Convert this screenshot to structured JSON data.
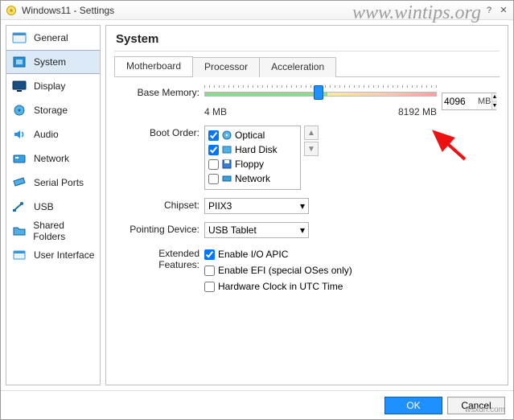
{
  "window": {
    "title": "Windows11 - Settings"
  },
  "watermark": "www.wintips.org",
  "watermark2": "wsxdn.com",
  "sidebar": {
    "items": [
      {
        "label": "General"
      },
      {
        "label": "System"
      },
      {
        "label": "Display"
      },
      {
        "label": "Storage"
      },
      {
        "label": "Audio"
      },
      {
        "label": "Network"
      },
      {
        "label": "Serial Ports"
      },
      {
        "label": "USB"
      },
      {
        "label": "Shared Folders"
      },
      {
        "label": "User Interface"
      }
    ],
    "selected": 1
  },
  "page": {
    "title": "System"
  },
  "tabs": {
    "items": [
      {
        "label": "Motherboard"
      },
      {
        "label": "Processor"
      },
      {
        "label": "Acceleration"
      }
    ],
    "selected": 0
  },
  "motherboard": {
    "base_memory_label": "Base Memory:",
    "base_memory_value": "4096",
    "base_memory_unit": "MB",
    "mem_min_label": "4 MB",
    "mem_max_label": "8192 MB",
    "boot_order_label": "Boot Order:",
    "boot_items": [
      {
        "label": "Optical",
        "checked": true
      },
      {
        "label": "Hard Disk",
        "checked": true
      },
      {
        "label": "Floppy",
        "checked": false
      },
      {
        "label": "Network",
        "checked": false
      }
    ],
    "chipset_label": "Chipset:",
    "chipset_value": "PIIX3",
    "pointing_label": "Pointing Device:",
    "pointing_value": "USB Tablet",
    "ext_label": "Extended Features:",
    "ext_apic": {
      "label": "Enable I/O APIC",
      "checked": true
    },
    "ext_efi": {
      "label": "Enable EFI (special OSes only)",
      "checked": false
    },
    "ext_utc": {
      "label": "Hardware Clock in UTC Time",
      "checked": false
    }
  },
  "footer": {
    "ok": "OK",
    "cancel": "Cancel"
  }
}
